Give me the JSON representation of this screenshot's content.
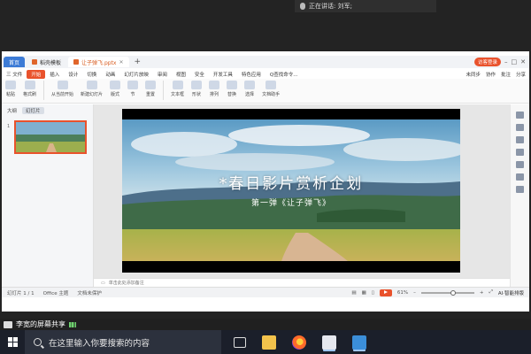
{
  "meeting": {
    "speaking_text": "正在讲话: 刘军;"
  },
  "tabs": [
    {
      "label": "首页"
    },
    {
      "label": "稻壳模板"
    },
    {
      "label": "让子弹飞.pptx"
    }
  ],
  "header_right": {
    "login_label": "访客登录"
  },
  "menu": {
    "items": [
      "三 文件",
      "开始",
      "插入",
      "设计",
      "切换",
      "动画",
      "幻灯片放映",
      "审阅",
      "视图",
      "安全",
      "开发工具",
      "特色应用"
    ],
    "active_index": 1,
    "search_placeholder": "Q查找命令...",
    "right_items": [
      "未同步",
      "协作",
      "批注",
      "分享"
    ]
  },
  "ribbon": {
    "groups": [
      "粘贴",
      "格式刷",
      "从当前开始",
      "新建幻灯片",
      "版式",
      "节",
      "重置",
      "文本框",
      "形状",
      "排列",
      "替换",
      "选择",
      "文档助手"
    ]
  },
  "thumbnails": {
    "tabs": [
      "大纲",
      "幻灯片"
    ],
    "selected_tab": 1,
    "slide_number": "1"
  },
  "slide": {
    "title": "*春日影片赏析企划",
    "subtitle": "第一弹《让子弹飞》"
  },
  "notes": {
    "placeholder": "单击此处添加备注"
  },
  "statusbar": {
    "slide_info": "幻灯片 1 / 1",
    "theme": "Office 主题",
    "protect": "文档未保护",
    "zoom": "61%",
    "zoom_fraction": 0.61,
    "ai_label": "AI·智能排版"
  },
  "screenshare": {
    "label": "李宽的屏幕共享"
  },
  "taskbar": {
    "search_placeholder": "在这里输入你要搜索的内容"
  },
  "colors": {
    "accent": "#e9522c",
    "home_tab": "#3c7bd6",
    "taskbar": "#1b1f2a"
  }
}
